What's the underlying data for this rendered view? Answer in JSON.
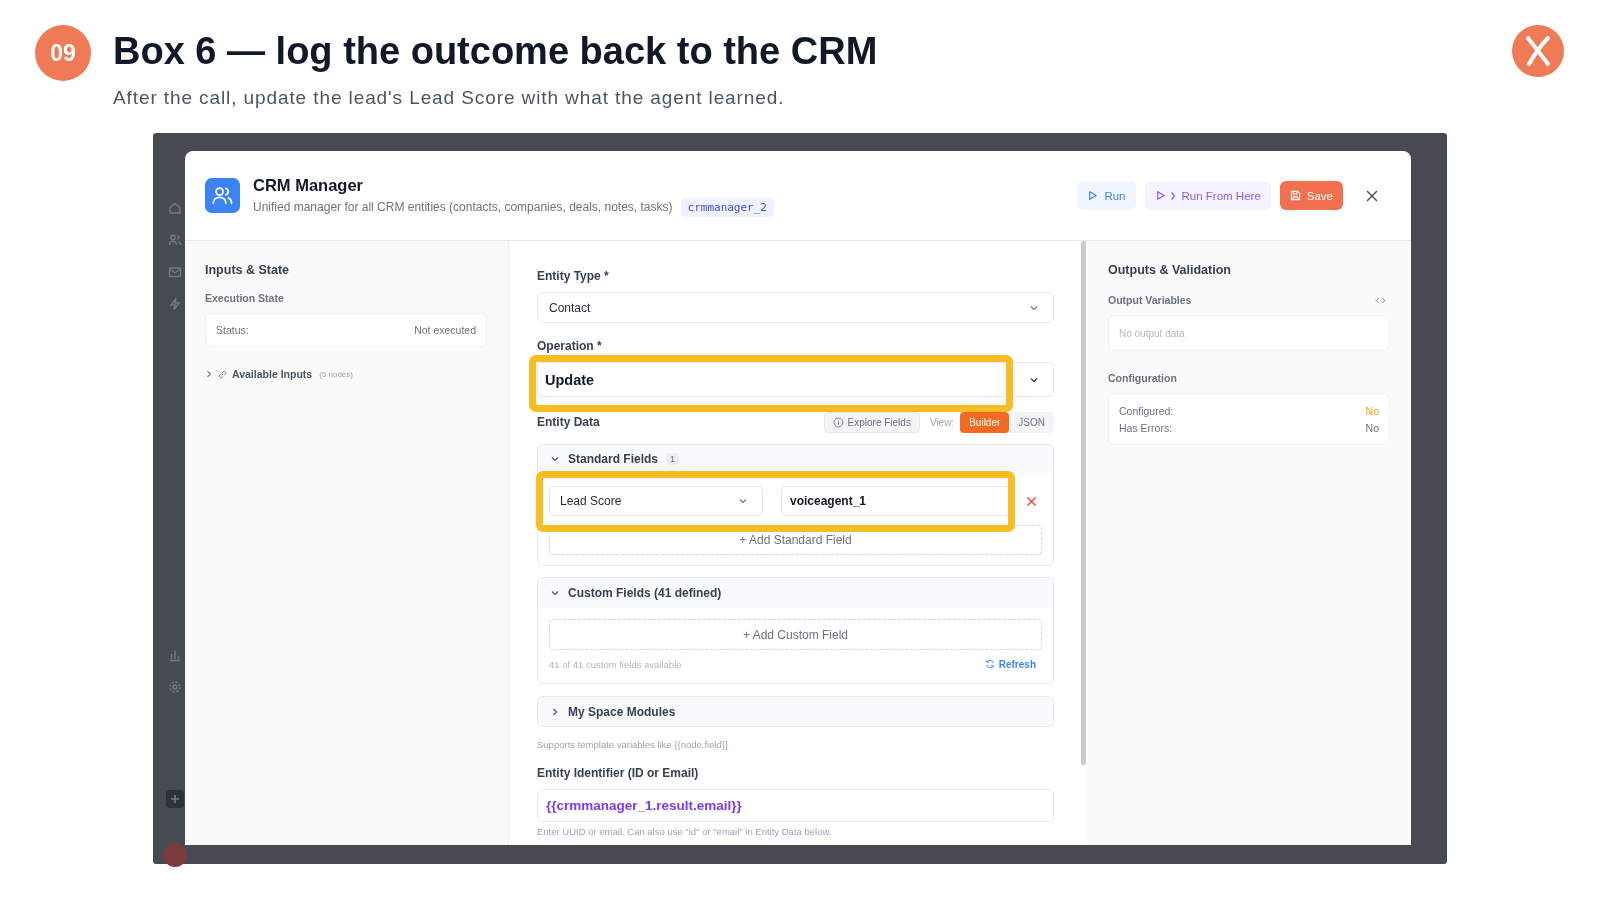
{
  "slide": {
    "step": "09",
    "title": "Box 6 — log the outcome back to the CRM",
    "subtitle": "After the call, update the lead's Lead Score with what the agent learned."
  },
  "modal": {
    "title": "CRM Manager",
    "description": "Unified manager for all CRM entities (contacts, companies, deals, notes, tasks)",
    "node_id": "crmmanager_2",
    "actions": [
      {
        "kind": "run",
        "label": "Run"
      },
      {
        "kind": "run_from_here",
        "label": "Run From Here"
      },
      {
        "kind": "save",
        "label": "Save"
      }
    ]
  },
  "inputs_panel": {
    "title": "Inputs & State",
    "section": "Execution State",
    "status_label": "Status:",
    "status_value": "Not executed",
    "available_inputs": {
      "label": "Available Inputs",
      "count": "(5 nodes)",
      "expanded": false
    }
  },
  "form": {
    "entity_type": {
      "label": "Entity Type *",
      "value": "Contact"
    },
    "operation": {
      "label": "Operation *",
      "value": "Update",
      "highlighted": true
    },
    "entity_data": {
      "label": "Entity Data",
      "explore_button": "Explore Fields",
      "view_label": "View:",
      "views": [
        {
          "label": "Builder",
          "selected": true
        },
        {
          "label": "JSON",
          "selected": false
        }
      ]
    },
    "sections": [
      {
        "kind": "standard",
        "title": "Standard Fields",
        "count": "1",
        "expanded": true,
        "fields": [
          {
            "name": "Lead Score",
            "value": "voiceagent_1",
            "highlighted": true
          }
        ],
        "add_label": "+ Add Standard Field"
      },
      {
        "kind": "custom",
        "title": "Custom Fields (41 defined)",
        "expanded": true,
        "add_label": "+ Add Custom Field",
        "footer": "41 of 41 custom fields available",
        "refresh": "Refresh"
      },
      {
        "kind": "modules",
        "title": "My Space Modules",
        "expanded": false
      }
    ],
    "hint": "Supports template variables like {{node.field}}",
    "entity_identifier": {
      "label": "Entity Identifier (ID or Email)",
      "value": "{{crmmanager_1.result.email}}",
      "help": "Enter UUID or email. Can also use \"id\" or \"email\" in Entity Data below."
    }
  },
  "outputs_panel": {
    "title": "Outputs & Validation",
    "variables_label": "Output Variables",
    "variables_placeholder": "No output data",
    "configuration_title": "Configuration",
    "checks": [
      {
        "label": "Configured:",
        "value": "No",
        "warning": true
      },
      {
        "label": "Has Errors:",
        "value": "No",
        "warning": false
      }
    ]
  }
}
